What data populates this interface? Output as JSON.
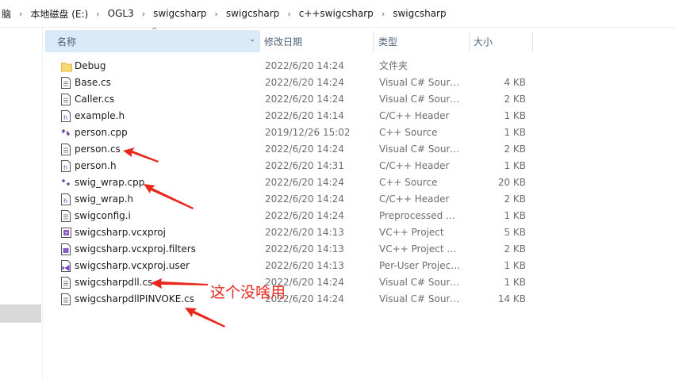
{
  "breadcrumb": [
    "脑",
    "本地磁盘 (E:)",
    "OGL3",
    "swigcsharp",
    "swigcsharp",
    "c++swigcsharp",
    "swigcsharp"
  ],
  "columns": {
    "name": "名称",
    "date": "修改日期",
    "type": "类型",
    "size": "大小"
  },
  "files": [
    {
      "name": "Debug",
      "date": "2022/6/20 14:24",
      "type": "文件夹",
      "size": "",
      "icon": "folder-icon"
    },
    {
      "name": "Base.cs",
      "date": "2022/6/20 14:24",
      "type": "Visual C# Source...",
      "size": "4 KB",
      "icon": "text-file-icon"
    },
    {
      "name": "Caller.cs",
      "date": "2022/6/20 14:24",
      "type": "Visual C# Source...",
      "size": "2 KB",
      "icon": "text-file-icon"
    },
    {
      "name": "example.h",
      "date": "2022/6/20 14:14",
      "type": "C/C++ Header",
      "size": "1 KB",
      "icon": "header-file-icon"
    },
    {
      "name": "person.cpp",
      "date": "2019/12/26 15:02",
      "type": "C++ Source",
      "size": "1 KB",
      "icon": "cpp-file-icon"
    },
    {
      "name": "person.cs",
      "date": "2022/6/20 14:24",
      "type": "Visual C# Source...",
      "size": "2 KB",
      "icon": "text-file-icon"
    },
    {
      "name": "person.h",
      "date": "2022/6/20 14:31",
      "type": "C/C++ Header",
      "size": "1 KB",
      "icon": "header-file-icon"
    },
    {
      "name": "swig_wrap.cpp",
      "date": "2022/6/20 14:24",
      "type": "C++ Source",
      "size": "20 KB",
      "icon": "cpp-file-icon"
    },
    {
      "name": "swig_wrap.h",
      "date": "2022/6/20 14:24",
      "type": "C/C++ Header",
      "size": "2 KB",
      "icon": "header-file-icon"
    },
    {
      "name": "swigconfig.i",
      "date": "2022/6/20 14:24",
      "type": "Preprocessed C/...",
      "size": "1 KB",
      "icon": "text-file-icon"
    },
    {
      "name": "swigcsharp.vcxproj",
      "date": "2022/6/20 14:13",
      "type": "VC++ Project",
      "size": "5 KB",
      "icon": "vcxproj-icon"
    },
    {
      "name": "swigcsharp.vcxproj.filters",
      "date": "2022/6/20 14:13",
      "type": "VC++ Project Fil...",
      "size": "2 KB",
      "icon": "filters-file-icon"
    },
    {
      "name": "swigcsharp.vcxproj.user",
      "date": "2022/6/20 14:13",
      "type": "Per-User Project...",
      "size": "1 KB",
      "icon": "vs-user-file-icon"
    },
    {
      "name": "swigcsharpdll.cs",
      "date": "2022/6/20 14:24",
      "type": "Visual C# Source...",
      "size": "1 KB",
      "icon": "text-file-icon"
    },
    {
      "name": "swigcsharpdllPINVOKE.cs",
      "date": "2022/6/20 14:24",
      "type": "Visual C# Source...",
      "size": "14 KB",
      "icon": "text-file-icon"
    }
  ],
  "annotation": {
    "text": "这个没啥用",
    "color": "#e8281d"
  }
}
